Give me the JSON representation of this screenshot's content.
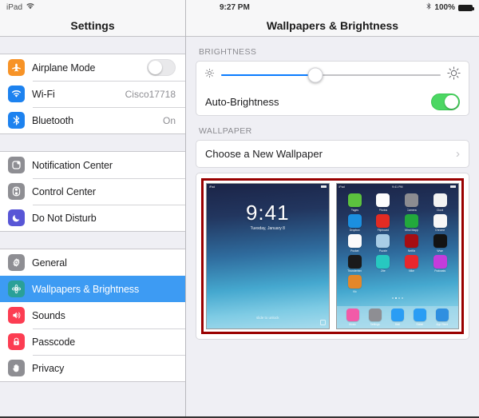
{
  "sidebar": {
    "status": {
      "device": "iPad",
      "wifi_icon": "wifi-icon"
    },
    "title": "Settings",
    "groups": [
      {
        "items": [
          {
            "label": "Airplane Mode",
            "icon": "airplane-icon",
            "icon_color": "#f79327",
            "control": "toggle",
            "toggle_on": false
          },
          {
            "label": "Wi-Fi",
            "icon": "wifi-icon",
            "icon_color": "#1d82ef",
            "value": "Cisco17718"
          },
          {
            "label": "Bluetooth",
            "icon": "bluetooth-icon",
            "icon_color": "#1d82ef",
            "value": "On"
          }
        ]
      },
      {
        "items": [
          {
            "label": "Notification Center",
            "icon": "notification-center-icon",
            "icon_color": "#8e8e93"
          },
          {
            "label": "Control Center",
            "icon": "control-center-icon",
            "icon_color": "#8e8e93"
          },
          {
            "label": "Do Not Disturb",
            "icon": "moon-icon",
            "icon_color": "#5856d6"
          }
        ]
      },
      {
        "items": [
          {
            "label": "General",
            "icon": "gear-icon",
            "icon_color": "#8e8e93"
          },
          {
            "label": "Wallpapers & Brightness",
            "icon": "flower-icon",
            "icon_color": "#2aa098",
            "selected": true
          },
          {
            "label": "Sounds",
            "icon": "speaker-icon",
            "icon_color": "#fc3d52"
          },
          {
            "label": "Passcode",
            "icon": "lock-icon",
            "icon_color": "#fc3d52"
          },
          {
            "label": "Privacy",
            "icon": "hand-icon",
            "icon_color": "#8e8e93"
          }
        ]
      }
    ]
  },
  "detail": {
    "status": {
      "time": "9:27 PM",
      "bluetooth_icon": "bluetooth-icon",
      "battery_percent": "100%"
    },
    "title": "Wallpapers & Brightness",
    "brightness": {
      "header": "BRIGHTNESS",
      "slider_value": 43,
      "low_icon": "sun-small-icon",
      "high_icon": "sun-large-icon",
      "auto_label": "Auto-Brightness",
      "auto_on": true
    },
    "wallpaper": {
      "header": "WALLPAPER",
      "choose_label": "Choose a New Wallpaper",
      "chevron": "›",
      "highlight_color": "#990000",
      "lock_preview": {
        "device": "iPad",
        "time": "9:41",
        "date": "Tuesday, January 8",
        "slide_text": "slide to unlock"
      },
      "home_preview": {
        "device": "iPad",
        "time": "9:41 PM",
        "apps": [
          {
            "name": "Pages",
            "color": "#5cc23e"
          },
          {
            "name": "Photos",
            "color": "#fdfdfd"
          },
          {
            "name": "Camera",
            "color": "#8c8c91"
          },
          {
            "name": "Clock",
            "color": "#f2f2f2"
          },
          {
            "name": "Dropbox",
            "color": "#1b8fe0"
          },
          {
            "name": "Flipboard",
            "color": "#e32b23"
          },
          {
            "name": "Mind Mapp",
            "color": "#22a93c"
          },
          {
            "name": "Chrome",
            "color": "#f7f7f7"
          },
          {
            "name": "Pocket",
            "color": "#fbfbfb"
          },
          {
            "name": "Puzzle",
            "color": "#a8cde6"
          },
          {
            "name": "Netflix",
            "color": "#a60d12"
          },
          {
            "name": "Wwe",
            "color": "#131313"
          },
          {
            "name": "Thunderbird",
            "color": "#1a1a1a"
          },
          {
            "name": "Zite",
            "color": "#27c8c0"
          },
          {
            "name": "Nike",
            "color": "#e8272c"
          },
          {
            "name": "Podcasts",
            "color": "#c33cdb"
          },
          {
            "name": "Vlc",
            "color": "#e3872a"
          }
        ],
        "dock": [
          {
            "name": "Music",
            "color": "#f25ba8"
          },
          {
            "name": "Settings",
            "color": "#8e8e93"
          },
          {
            "name": "Mail",
            "color": "#2a9df4"
          },
          {
            "name": "Safari",
            "color": "#2a9df4"
          },
          {
            "name": "App Store",
            "color": "#2f8fe0"
          }
        ],
        "page_dots": 4,
        "active_dot": 1
      }
    }
  }
}
